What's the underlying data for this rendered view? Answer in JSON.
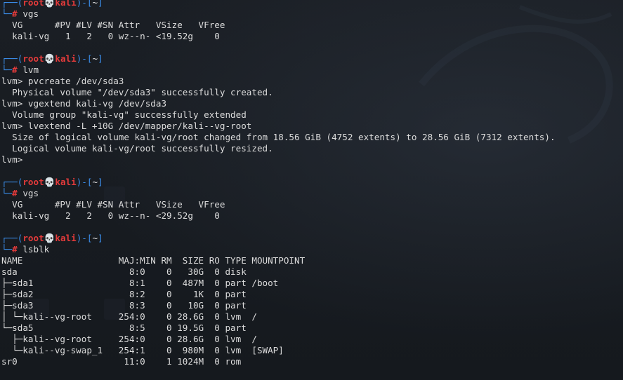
{
  "prompt": {
    "user": "root",
    "host": "kali",
    "skull": "💀",
    "cwd": "~"
  },
  "blocks": [
    {
      "command": "vgs",
      "output": [
        "  VG      #PV #LV #SN Attr   VSize   VFree",
        "  kali-vg   1   2   0 wz--n- <19.52g    0"
      ]
    },
    {
      "command": "lvm",
      "output": [
        "lvm> pvcreate /dev/sda3",
        "  Physical volume \"/dev/sda3\" successfully created.",
        "lvm> vgextend kali-vg /dev/sda3",
        "  Volume group \"kali-vg\" successfully extended",
        "lvm> lvextend -L +10G /dev/mapper/kali--vg-root",
        "  Size of logical volume kali-vg/root changed from 18.56 GiB (4752 extents) to 28.56 GiB (7312 extents).",
        "  Logical volume kali-vg/root successfully resized.",
        "lvm>"
      ]
    },
    {
      "command": "vgs",
      "output": [
        "  VG      #PV #LV #SN Attr   VSize   VFree",
        "  kali-vg   2   2   0 wz--n- <29.52g    0"
      ]
    },
    {
      "command": "lsblk",
      "output": [
        "NAME                  MAJ:MIN RM  SIZE RO TYPE MOUNTPOINT",
        "sda                     8:0    0   30G  0 disk",
        "├─sda1                  8:1    0  487M  0 part /boot",
        "├─sda2                  8:2    0    1K  0 part",
        "├─sda3                  8:3    0   10G  0 part",
        "│ └─kali--vg-root     254:0    0 28.6G  0 lvm  /",
        "└─sda5                  8:5    0 19.5G  0 part",
        "  ├─kali--vg-root     254:0    0 28.6G  0 lvm  /",
        "  └─kali--vg-swap_1   254:1    0  980M  0 lvm  [SWAP]",
        "sr0                    11:0    1 1024M  0 rom"
      ]
    }
  ],
  "colors": {
    "background": "#161a1f",
    "prompt_frame": "#3b8eea",
    "prompt_user": "#e53b3b",
    "text": "#dcdcdc"
  },
  "background_icons": [
    "kali-dragon-watermark",
    "desktop-file-icons"
  ]
}
